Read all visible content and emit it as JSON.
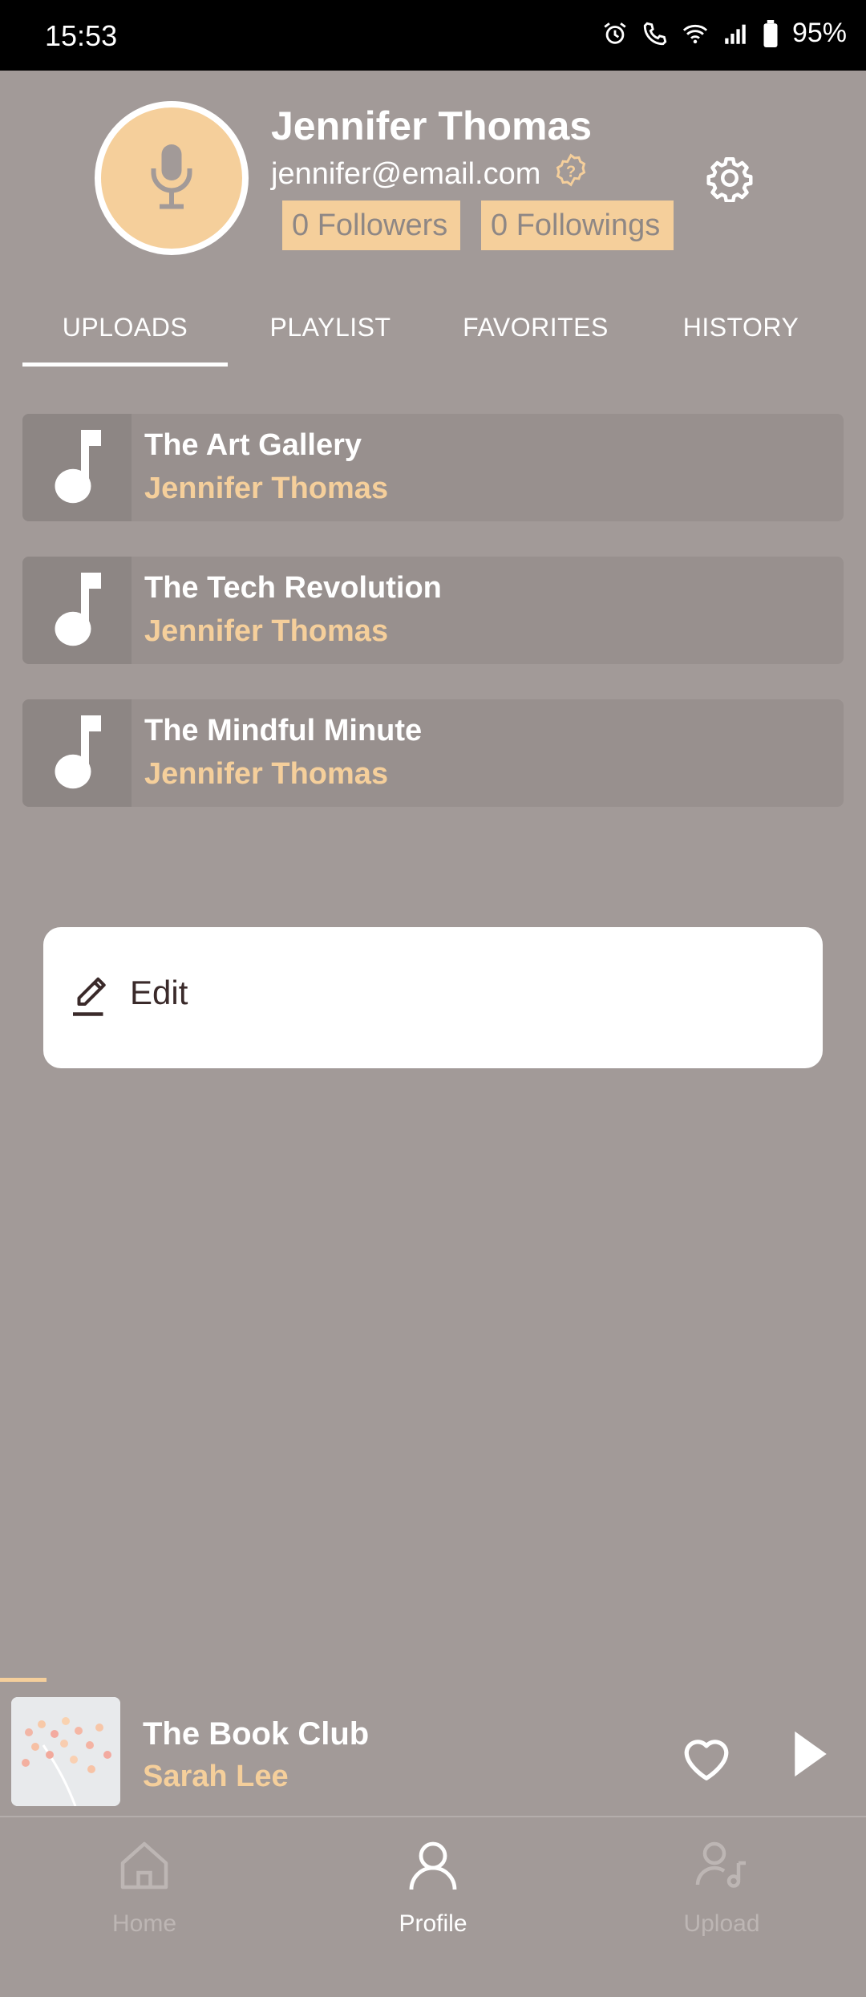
{
  "status_bar": {
    "time": "15:53",
    "battery": "95%"
  },
  "profile": {
    "name": "Jennifer Thomas",
    "email": "jennifer@email.com",
    "followers": "0 Followers",
    "followings": "0 Followings"
  },
  "tabs": [
    {
      "label": "UPLOADS",
      "active": true
    },
    {
      "label": "PLAYLIST",
      "active": false
    },
    {
      "label": "FAVORITES",
      "active": false
    },
    {
      "label": "HISTORY",
      "active": false
    }
  ],
  "uploads": [
    {
      "title": "The Art Gallery",
      "artist": "Jennifer Thomas"
    },
    {
      "title": "The Tech Revolution",
      "artist": "Jennifer Thomas"
    },
    {
      "title": "The Mindful Minute",
      "artist": "Jennifer Thomas"
    }
  ],
  "context_menu": {
    "edit_label": "Edit"
  },
  "player": {
    "title": "The Book Club",
    "artist": "Sarah Lee"
  },
  "bottom_nav": [
    {
      "label": "Home",
      "active": false
    },
    {
      "label": "Profile",
      "active": true
    },
    {
      "label": "Upload",
      "active": false
    }
  ],
  "colors": {
    "accent": "#f5cf9b",
    "background": "#a29a98",
    "card": "#98908e",
    "inactive_nav": "#bdb6b4"
  }
}
